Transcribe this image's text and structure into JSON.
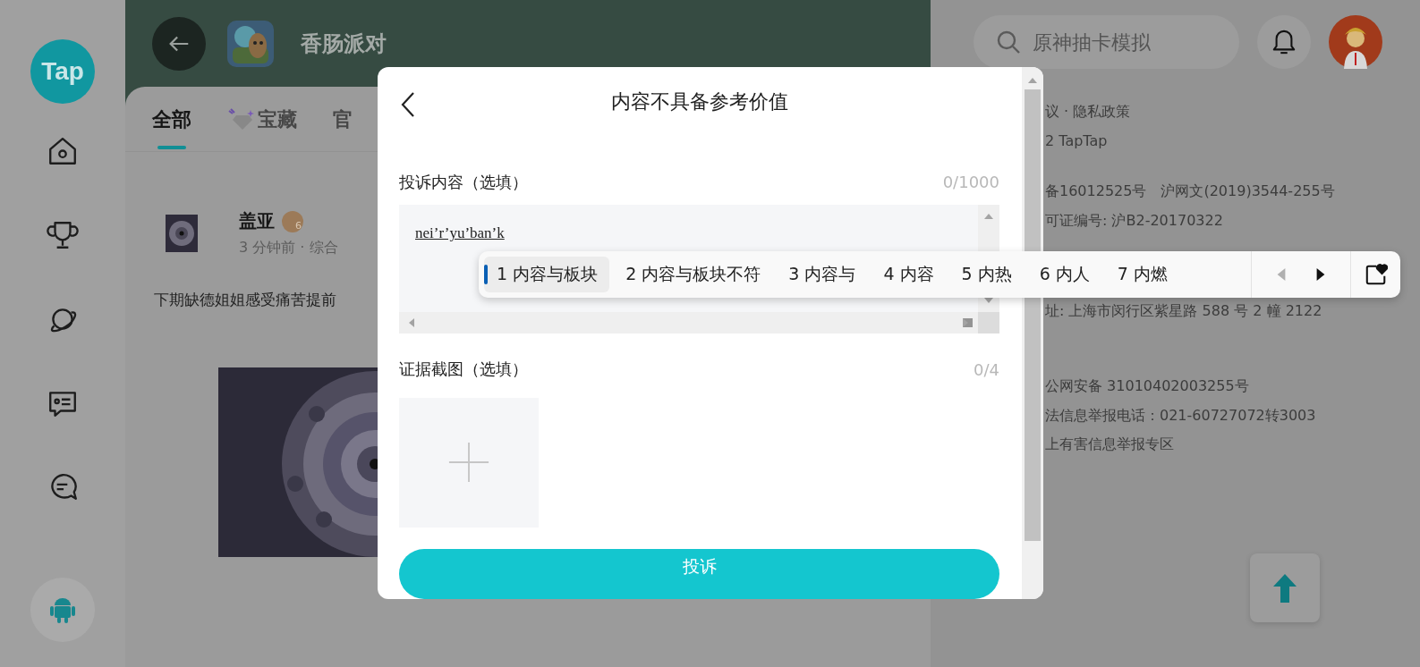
{
  "sidebar": {
    "logo": "Tap",
    "items": [
      {
        "kind": "home"
      },
      {
        "kind": "trophy"
      },
      {
        "kind": "planet"
      },
      {
        "kind": "card"
      },
      {
        "kind": "chat"
      }
    ]
  },
  "header": {
    "title": "香肠派对"
  },
  "tabs": [
    {
      "label": "全部",
      "selected": true,
      "kind": "plain"
    },
    {
      "label": "宝藏",
      "selected": false,
      "kind": "gem"
    },
    {
      "label": "官",
      "selected": false,
      "kind": "plain"
    }
  ],
  "post": {
    "author": "盖亚",
    "badge": "6",
    "meta": "3 分钟前 · 综合",
    "text": "下期缺德姐姐感受痛苦提前"
  },
  "search": {
    "placeholder": "原神抽卡模拟"
  },
  "footer": [
    "议 · 隐私政策",
    "2 TapTap",
    "备16012525号　沪网文(2019)3544-255号",
    "可证编号: 沪B2-20170322",
    "址: 上海市闵行区紫星路 588 号 2 幢 2122",
    "公网安备 31010402003255号",
    "法信息举报电话：021-60727072转3003",
    "上有害信息举报专区"
  ],
  "dialog": {
    "title": "内容不具备参考价值",
    "content_label": "投诉内容（选填）",
    "content_counter": "0/1000",
    "content_value": "nei’r’yu’ban’k",
    "evidence_label": "证据截图（选填）",
    "evidence_counter": "0/4",
    "submit": "投诉"
  },
  "ime": {
    "candidates": [
      {
        "number": "1",
        "text": "内容与板块",
        "selected": true
      },
      {
        "number": "2",
        "text": "内容与板块不符",
        "selected": false
      },
      {
        "number": "3",
        "text": "内容与",
        "selected": false
      },
      {
        "number": "4",
        "text": "内容",
        "selected": false
      },
      {
        "number": "5",
        "text": "内热",
        "selected": false
      },
      {
        "number": "6",
        "text": "内人",
        "selected": false
      },
      {
        "number": "7",
        "text": "内燃",
        "selected": false
      }
    ],
    "prev_disabled": true,
    "next_disabled": false
  }
}
